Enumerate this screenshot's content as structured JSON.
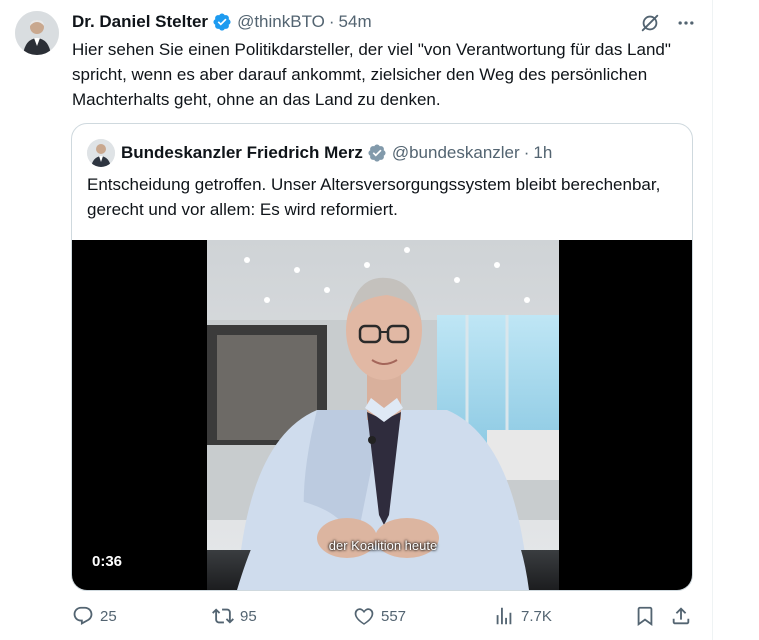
{
  "tweet": {
    "author_name": "Dr. Daniel Stelter",
    "handle": "@thinkBTO",
    "separator": "·",
    "time": "54m",
    "text": "Hier sehen Sie einen Politikdarsteller, der viel \"von Verantwortung für das Land\" spricht, wenn es aber darauf ankommt, zielsicher den Weg des persönlichen Machterhalts geht, ohne an das Land zu denken.",
    "icons": [
      "grok-icon",
      "more-icon"
    ]
  },
  "quoted": {
    "author_name": "Bundeskanzler Friedrich Merz",
    "handle": "@bundeskanzler",
    "separator": "·",
    "time": "1h",
    "text": "Entscheidung getroffen. Unser Altersversorgungssystem bleibt berechenbar, gerecht und vor allem: Es wird reformiert.",
    "video": {
      "caption": "der Koalition heute",
      "duration": "0:36"
    }
  },
  "actions": {
    "replies": "25",
    "reposts": "95",
    "likes": "557",
    "views": "7.7K",
    "icons": [
      "reply-icon",
      "repost-icon",
      "like-icon",
      "views-icon",
      "bookmark-icon",
      "share-icon"
    ]
  },
  "colors": {
    "text": "#0f1419",
    "secondary": "#536471",
    "verified_blue": "#1d9bf0",
    "verified_gray": "#829aab",
    "border": "#cfd9de"
  }
}
